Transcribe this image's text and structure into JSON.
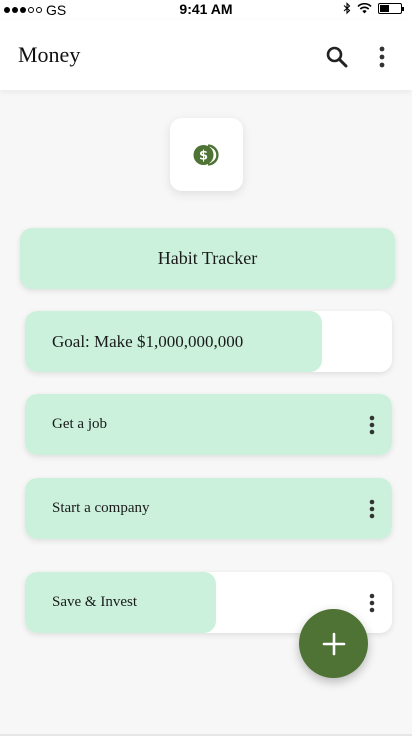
{
  "status_bar": {
    "carrier": "GS",
    "time": "9:41 AM",
    "battery_level": 0.45
  },
  "app_bar": {
    "title": "Money",
    "search_icon": "search-icon",
    "menu_icon": "more-vert-icon"
  },
  "logo": {
    "icon": "dollar-coin-icon",
    "color": "#4e7335"
  },
  "tracker": {
    "header": "Habit Tracker",
    "goal": {
      "label": "Goal: Make $1,000,000,000",
      "progress": 0.81
    },
    "items": [
      {
        "label": "Get a job",
        "progress": 1.0
      },
      {
        "label": "Start a company",
        "progress": 1.0
      },
      {
        "label": "Save & Invest",
        "progress": 0.52
      }
    ]
  },
  "fab": {
    "icon": "plus-icon",
    "color": "#4e7335"
  },
  "colors": {
    "accent": "#4e7335",
    "progress_fill": "#cbf1dc"
  }
}
